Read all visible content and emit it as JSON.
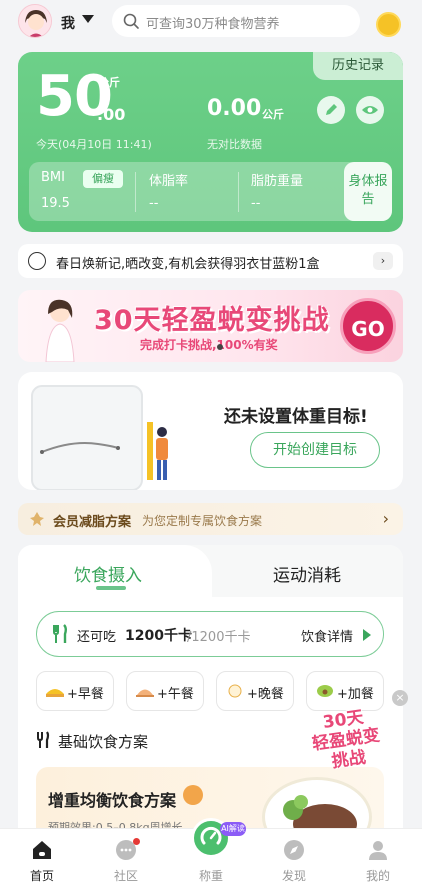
{
  "header": {
    "user_label": "我",
    "search_placeholder": "可查询30万种食物营养"
  },
  "weight_card": {
    "history_label": "历史记录",
    "weight_integer": "50",
    "weight_decimal": ".00",
    "weight_unit": "公斤",
    "date_text": "今天(04月10日 11:41)",
    "compare_value": "0.00",
    "compare_unit": "公斤",
    "compare_note": "无对比数据",
    "bmi_label": "BMI",
    "bmi_badge": "偏瘦",
    "bmi_value": "19.5",
    "body_fat_label": "体脂率",
    "body_fat_value": "--",
    "fat_weight_label": "脂肪重量",
    "fat_weight_value": "--",
    "report_label": "身体报告"
  },
  "notice": {
    "text": "春日焕新记,晒改变,有机会获得羽衣甘蓝粉1盒",
    "arrow": "›"
  },
  "banner": {
    "title": "30天轻盈蜕变挑战",
    "subtitle": "完成打卡挑战,100%有奖",
    "go_label": "GO"
  },
  "goal": {
    "text": "还未设置体重目标!",
    "button_label": "开始创建目标"
  },
  "member": {
    "title": "会员减脂方案",
    "subtitle": "为您定制专属饮食方案",
    "arrow": "›"
  },
  "diet": {
    "tab_intake": "饮食摄入",
    "tab_exercise": "运动消耗",
    "remain_label": "还可吃",
    "remain_value": "1200千卡",
    "remain_total": "/1200千卡",
    "detail_label": "饮食详情",
    "meals": [
      "+早餐",
      "+午餐",
      "+晚餐",
      "+加餐"
    ],
    "plan_header": "基础饮食方案",
    "plan_title": "增重均衡饮食方案",
    "plan_effect": "预期效果:0.5–0.8kg周增长"
  },
  "floating": {
    "text_line1": "30天",
    "text_line2": "轻盈蜕变",
    "text_line3": "挑战",
    "close": "×"
  },
  "tabbar": {
    "home": "首页",
    "community": "社区",
    "scale": "称重",
    "ai_tag": "AI解读",
    "discover": "发现",
    "mine": "我的"
  },
  "colors": {
    "primary_green": "#5ec67c",
    "accent_pink": "#e84878",
    "go_red": "#d92c5f",
    "member_gold": "#6b4a1c"
  }
}
